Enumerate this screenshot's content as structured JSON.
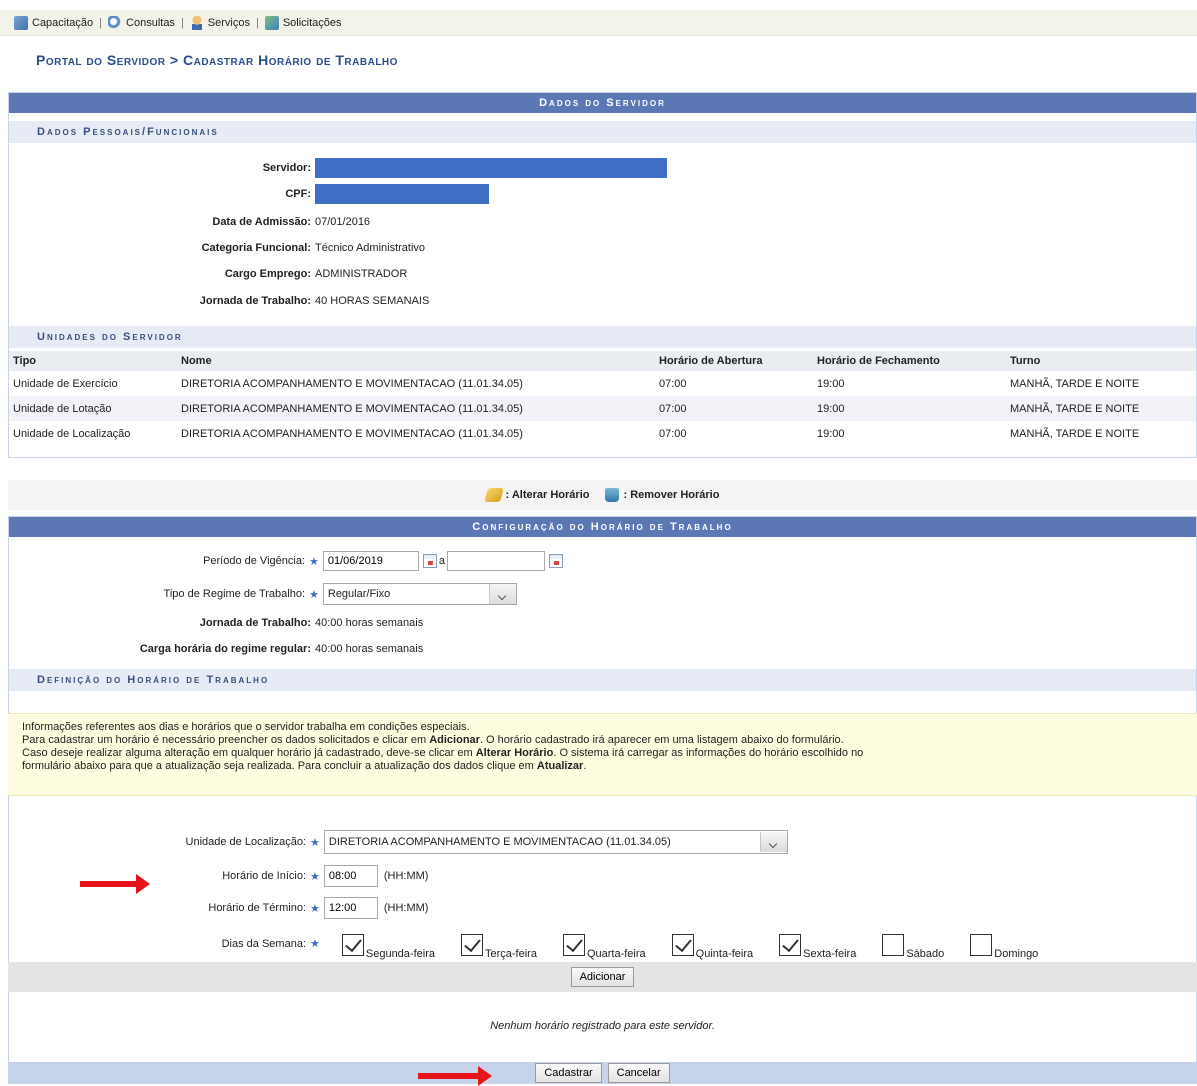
{
  "topmenu": {
    "items": [
      {
        "label": "Capacitação",
        "icon": "capacitacao-icon"
      },
      {
        "label": "Consultas",
        "icon": "search-icon"
      },
      {
        "label": "Serviços",
        "icon": "user-icon"
      },
      {
        "label": "Solicitações",
        "icon": "document-icon"
      }
    ]
  },
  "breadcrumb": "Portal do Servidor > Cadastrar Horário de Trabalho",
  "dados": {
    "title": "Dados do Servidor",
    "pessoais_title": "Dados Pessoais/Funcionais",
    "fields": [
      {
        "label": "Servidor:",
        "value": ""
      },
      {
        "label": "CPF:",
        "value": ""
      },
      {
        "label": "Data de Admissão:",
        "value": "07/01/2016"
      },
      {
        "label": "Categoria Funcional:",
        "value": "Técnico Administrativo"
      },
      {
        "label": "Cargo Emprego:",
        "value": "ADMINISTRADOR"
      },
      {
        "label": "Jornada de Trabalho:",
        "value": "40 HORAS SEMANAIS"
      }
    ],
    "unidades_title": "Unidades do Servidor",
    "unidades_columns": [
      "Tipo",
      "Nome",
      "Horário de Abertura",
      "Horário de Fechamento",
      "Turno"
    ],
    "unidades_rows": [
      [
        "Unidade de Exercício",
        "DIRETORIA ACOMPANHAMENTO E MOVIMENTACAO (11.01.34.05)",
        "07:00",
        "19:00",
        "MANHÃ, TARDE E NOITE"
      ],
      [
        "Unidade de Lotação",
        "DIRETORIA ACOMPANHAMENTO E MOVIMENTACAO (11.01.34.05)",
        "07:00",
        "19:00",
        "MANHÃ, TARDE E NOITE"
      ],
      [
        "Unidade de Localização",
        "DIRETORIA ACOMPANHAMENTO E MOVIMENTACAO (11.01.34.05)",
        "07:00",
        "19:00",
        "MANHÃ, TARDE E NOITE"
      ]
    ]
  },
  "legend": {
    "alterar": ": Alterar Horário",
    "remover": ": Remover Horário"
  },
  "config": {
    "title": "Configuração do Horário de Trabalho",
    "periodo_label": "Período de Vigência:",
    "periodo_inicio": "01/06/2019",
    "periodo_sep": "a",
    "periodo_fim": "",
    "regime_label": "Tipo de Regime de Trabalho:",
    "regime_value": "Regular/Fixo",
    "jornada_label": "Jornada de Trabalho:",
    "jornada_value": "40:00 horas semanais",
    "carga_label": "Carga horária do regime regular:",
    "carga_value": "40:00 horas semanais"
  },
  "definicao": {
    "title": "Definição do Horário de Trabalho",
    "info_line1": "Informações referentes aos dias e horários que o servidor trabalha em condições especiais.",
    "info_line2_a": "Para cadastrar um horário é necessário preencher os dados solicitados e clicar em ",
    "info_line2_b": "Adicionar",
    "info_line2_c": ". O horário cadastrado irá aparecer em uma listagem abaixo do formulário.",
    "info_line3_a": "Caso deseje realizar alguma alteração em qualquer horário já cadastrado, deve-se clicar em ",
    "info_line3_b": "Alterar Horário",
    "info_line3_c": ". O sistema irá carregar as informações do horário escolhido no",
    "info_line4_a": "formulário abaixo para que a atualização seja realizada. Para concluir a atualização dos dados clique em ",
    "info_line4_b": "Atualizar",
    "info_line4_c": ".",
    "unidade_label": "Unidade de Localização:",
    "unidade_value": "DIRETORIA ACOMPANHAMENTO E MOVIMENTACAO (11.01.34.05)",
    "inicio_label": "Horário de Início:",
    "inicio_value": "08:00",
    "termino_label": "Horário de Término:",
    "termino_value": "12:00",
    "hhmm": "(HH:MM)",
    "dias_label": "Dias da Semana:",
    "dias": [
      {
        "label": "Segunda-feira",
        "checked": true
      },
      {
        "label": "Terça-feira",
        "checked": true
      },
      {
        "label": "Quarta-feira",
        "checked": true
      },
      {
        "label": "Quinta-feira",
        "checked": true
      },
      {
        "label": "Sexta-feira",
        "checked": true
      },
      {
        "label": "Sábado",
        "checked": false
      },
      {
        "label": "Domingo",
        "checked": false
      }
    ],
    "adicionar": "Adicionar",
    "nenhum": "Nenhum horário registrado para este servidor."
  },
  "footer": {
    "cadastrar": "Cadastrar",
    "cancelar": "Cancelar"
  },
  "colors": {
    "panel_header": "#5c78b4",
    "breadcrumb": "#2b4d8c",
    "redacted": "#3f6fc4",
    "arrow": "#e8141c",
    "info_bg": "#fffde0"
  }
}
